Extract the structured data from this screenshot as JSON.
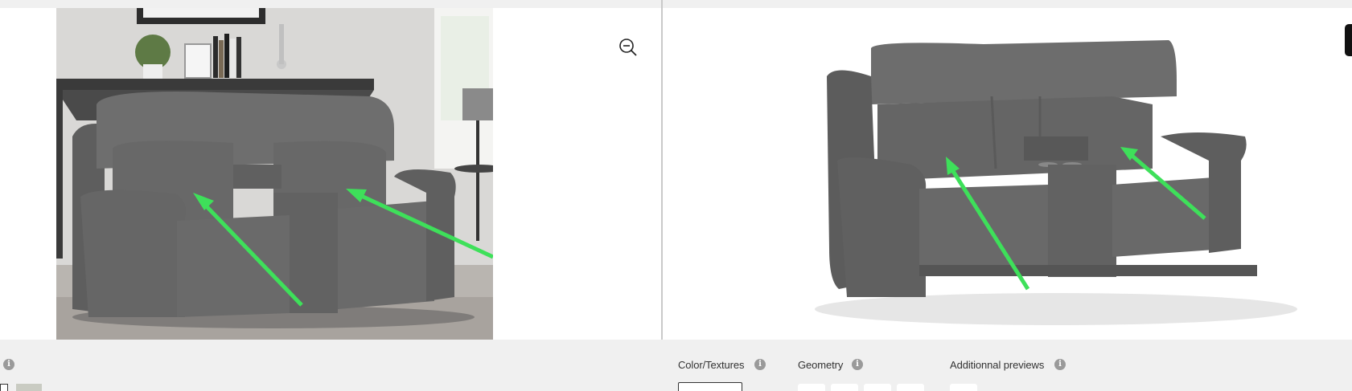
{
  "left_panel": {
    "photo": {
      "alt": "Gray reclining loveseat with center console in living room"
    },
    "zoom_icon": "zoom-out-icon"
  },
  "right_panel": {
    "render": {
      "alt": "Gray reclining loveseat with center console, 3D render"
    }
  },
  "bottom_bar": {
    "sections": [
      {
        "label": "Color/Textures"
      },
      {
        "label": "Geometry"
      },
      {
        "label": "Additionnal previews"
      }
    ],
    "info_glyph": "i"
  },
  "colors": {
    "panel_bg": "#ffffff",
    "bar_bg": "#f0f0f0",
    "arrow": "#3ee05a",
    "sofa": "#6b6b6b"
  }
}
